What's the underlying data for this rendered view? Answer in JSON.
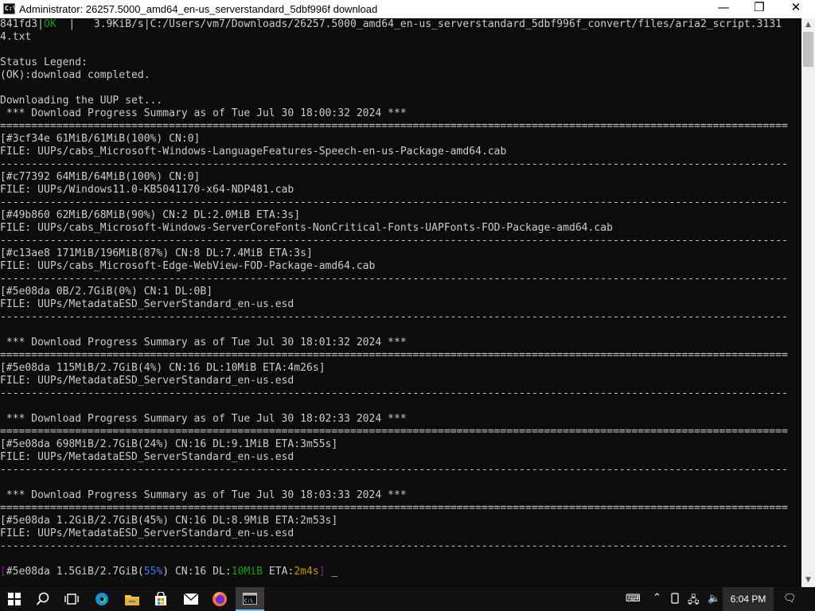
{
  "window": {
    "title": "Administrator:  26257.5000_amd64_en-us_serverstandard_5dbf996f download",
    "icon_name": "cmd-icon",
    "icon_text": "C:\\",
    "minimize_symbol": "—",
    "maximize_symbol": "❐",
    "close_symbol": "✕"
  },
  "console": {
    "lines": [
      {
        "segments": [
          {
            "text": "841fd3|",
            "color": "#cccccc"
          },
          {
            "text": "OK",
            "color": "#13a10e"
          },
          {
            "text": "  |   3.9KiB/s|C:/Users/vm7/Downloads/26257.5000_amd64_en-us_serverstandard_5dbf996f_convert/files/aria2_script.3131",
            "color": "#cccccc"
          }
        ]
      },
      {
        "segments": [
          {
            "text": "4.txt",
            "color": "#cccccc"
          }
        ]
      },
      {
        "segments": [
          {
            "text": "",
            "color": "#cccccc"
          }
        ]
      },
      {
        "segments": [
          {
            "text": "Status Legend:",
            "color": "#cccccc"
          }
        ]
      },
      {
        "segments": [
          {
            "text": "(OK):download completed.",
            "color": "#cccccc"
          }
        ]
      },
      {
        "segments": [
          {
            "text": "",
            "color": "#cccccc"
          }
        ]
      },
      {
        "segments": [
          {
            "text": "Downloading the UUP set...",
            "color": "#cccccc"
          }
        ]
      },
      {
        "segments": [
          {
            "text": " *** Download Progress Summary as of Tue Jul 30 18:00:32 2024 ***",
            "color": "#cccccc"
          }
        ]
      },
      {
        "segments": [
          {
            "text": "==============================================================================================================================",
            "color": "#cccccc"
          }
        ]
      },
      {
        "segments": [
          {
            "text": "[#3cf34e 61MiB/61MiB(100%) CN:0]",
            "color": "#cccccc"
          }
        ]
      },
      {
        "segments": [
          {
            "text": "FILE: UUPs/cabs_Microsoft-Windows-LanguageFeatures-Speech-en-us-Package-amd64.cab",
            "color": "#cccccc"
          }
        ]
      },
      {
        "segments": [
          {
            "text": "------------------------------------------------------------------------------------------------------------------------------",
            "color": "#cccccc"
          }
        ]
      },
      {
        "segments": [
          {
            "text": "[#c77392 64MiB/64MiB(100%) CN:0]",
            "color": "#cccccc"
          }
        ]
      },
      {
        "segments": [
          {
            "text": "FILE: UUPs/Windows11.0-KB5041170-x64-NDP481.cab",
            "color": "#cccccc"
          }
        ]
      },
      {
        "segments": [
          {
            "text": "------------------------------------------------------------------------------------------------------------------------------",
            "color": "#cccccc"
          }
        ]
      },
      {
        "segments": [
          {
            "text": "[#49b860 62MiB/68MiB(90%) CN:2 DL:2.0MiB ETA:3s]",
            "color": "#cccccc"
          }
        ]
      },
      {
        "segments": [
          {
            "text": "FILE: UUPs/cabs_Microsoft-Windows-ServerCoreFonts-NonCritical-Fonts-UAPFonts-FOD-Package-amd64.cab",
            "color": "#cccccc"
          }
        ]
      },
      {
        "segments": [
          {
            "text": "------------------------------------------------------------------------------------------------------------------------------",
            "color": "#cccccc"
          }
        ]
      },
      {
        "segments": [
          {
            "text": "[#c13ae8 171MiB/196MiB(87%) CN:8 DL:7.4MiB ETA:3s]",
            "color": "#cccccc"
          }
        ]
      },
      {
        "segments": [
          {
            "text": "FILE: UUPs/cabs_Microsoft-Edge-WebView-FOD-Package-amd64.cab",
            "color": "#cccccc"
          }
        ]
      },
      {
        "segments": [
          {
            "text": "------------------------------------------------------------------------------------------------------------------------------",
            "color": "#cccccc"
          }
        ]
      },
      {
        "segments": [
          {
            "text": "[#5e08da 0B/2.7GiB(0%) CN:1 DL:0B]",
            "color": "#cccccc"
          }
        ]
      },
      {
        "segments": [
          {
            "text": "FILE: UUPs/MetadataESD_ServerStandard_en-us.esd",
            "color": "#cccccc"
          }
        ]
      },
      {
        "segments": [
          {
            "text": "------------------------------------------------------------------------------------------------------------------------------",
            "color": "#cccccc"
          }
        ]
      },
      {
        "segments": [
          {
            "text": "",
            "color": "#cccccc"
          }
        ]
      },
      {
        "segments": [
          {
            "text": " *** Download Progress Summary as of Tue Jul 30 18:01:32 2024 ***",
            "color": "#cccccc"
          }
        ]
      },
      {
        "segments": [
          {
            "text": "==============================================================================================================================",
            "color": "#cccccc"
          }
        ]
      },
      {
        "segments": [
          {
            "text": "[#5e08da 115MiB/2.7GiB(4%) CN:16 DL:10MiB ETA:4m26s]",
            "color": "#cccccc"
          }
        ]
      },
      {
        "segments": [
          {
            "text": "FILE: UUPs/MetadataESD_ServerStandard_en-us.esd",
            "color": "#cccccc"
          }
        ]
      },
      {
        "segments": [
          {
            "text": "------------------------------------------------------------------------------------------------------------------------------",
            "color": "#cccccc"
          }
        ]
      },
      {
        "segments": [
          {
            "text": "",
            "color": "#cccccc"
          }
        ]
      },
      {
        "segments": [
          {
            "text": " *** Download Progress Summary as of Tue Jul 30 18:02:33 2024 ***",
            "color": "#cccccc"
          }
        ]
      },
      {
        "segments": [
          {
            "text": "==============================================================================================================================",
            "color": "#cccccc"
          }
        ]
      },
      {
        "segments": [
          {
            "text": "[#5e08da 698MiB/2.7GiB(24%) CN:16 DL:9.1MiB ETA:3m55s]",
            "color": "#cccccc"
          }
        ]
      },
      {
        "segments": [
          {
            "text": "FILE: UUPs/MetadataESD_ServerStandard_en-us.esd",
            "color": "#cccccc"
          }
        ]
      },
      {
        "segments": [
          {
            "text": "------------------------------------------------------------------------------------------------------------------------------",
            "color": "#cccccc"
          }
        ]
      },
      {
        "segments": [
          {
            "text": "",
            "color": "#cccccc"
          }
        ]
      },
      {
        "segments": [
          {
            "text": " *** Download Progress Summary as of Tue Jul 30 18:03:33 2024 ***",
            "color": "#cccccc"
          }
        ]
      },
      {
        "segments": [
          {
            "text": "==============================================================================================================================",
            "color": "#cccccc"
          }
        ]
      },
      {
        "segments": [
          {
            "text": "[#5e08da 1.2GiB/2.7GiB(45%) CN:16 DL:8.9MiB ETA:2m53s]",
            "color": "#cccccc"
          }
        ]
      },
      {
        "segments": [
          {
            "text": "FILE: UUPs/MetadataESD_ServerStandard_en-us.esd",
            "color": "#cccccc"
          }
        ]
      },
      {
        "segments": [
          {
            "text": "------------------------------------------------------------------------------------------------------------------------------",
            "color": "#cccccc"
          }
        ]
      },
      {
        "segments": [
          {
            "text": "",
            "color": "#cccccc"
          }
        ]
      },
      {
        "segments": [
          {
            "text": "[",
            "color": "#881798"
          },
          {
            "text": "#5e08da 1.5GiB/2.7GiB(",
            "color": "#cccccc"
          },
          {
            "text": "55%",
            "color": "#3b78ff"
          },
          {
            "text": ") CN:16 DL:",
            "color": "#cccccc"
          },
          {
            "text": "10MiB",
            "color": "#13a10e"
          },
          {
            "text": " ETA:",
            "color": "#cccccc"
          },
          {
            "text": "2m4s",
            "color": "#c19c00"
          },
          {
            "text": "]",
            "color": "#881798"
          }
        ]
      }
    ],
    "cursor_symbol": "_"
  },
  "scrollbar": {
    "up_symbol": "▲",
    "down_symbol": "▼"
  },
  "taskbar": {
    "apps": [
      {
        "name": "start-icon",
        "glyph": ""
      },
      {
        "name": "search-icon",
        "glyph": ""
      },
      {
        "name": "task-view-icon",
        "glyph": ""
      },
      {
        "name": "edge-icon",
        "glyph": ""
      },
      {
        "name": "file-explorer-icon",
        "glyph": ""
      },
      {
        "name": "store-icon",
        "glyph": ""
      },
      {
        "name": "mail-icon",
        "glyph": ""
      },
      {
        "name": "firefox-icon",
        "glyph": ""
      },
      {
        "name": "cmd-taskbar-icon",
        "glyph": ""
      }
    ],
    "tray": {
      "keyboard_icon": "⌨",
      "chevron_up_icon": "⌃",
      "network_icon": "🖧",
      "volume_icon": "🔈",
      "notification_icon": "🗨"
    },
    "clock": "6:04 PM"
  },
  "colors": {
    "console_bg": "#0c0c0c",
    "console_fg": "#cccccc",
    "ok_green": "#13a10e",
    "accent_blue": "#3b78ff",
    "eta_yellow": "#c19c00",
    "bracket_magenta": "#881798",
    "taskbar_bg": "#101010"
  }
}
